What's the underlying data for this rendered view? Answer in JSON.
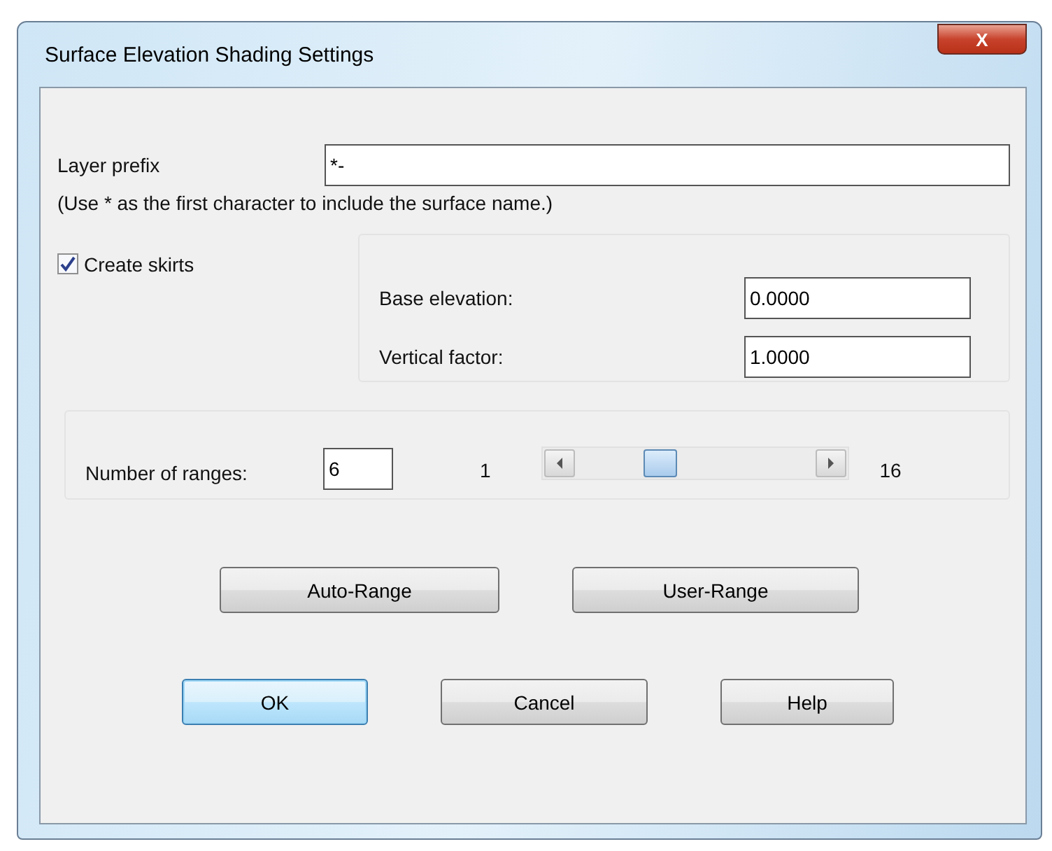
{
  "window": {
    "title": "Surface Elevation Shading Settings",
    "close_label": "X"
  },
  "layer_prefix": {
    "label": "Layer prefix",
    "value": "*-",
    "hint": "(Use * as the first character to include the surface name.)"
  },
  "create_skirts": {
    "label": "Create skirts",
    "checked": true
  },
  "skirt_fields": [
    {
      "label": "Base elevation:",
      "value": "0.0000"
    },
    {
      "label": "Vertical factor:",
      "value": "1.0000"
    }
  ],
  "ranges": {
    "label": "Number of ranges:",
    "value": "6",
    "min_label": "1",
    "max_label": "16",
    "level": 0.33
  },
  "range_buttons": [
    "Auto-Range",
    "User-Range"
  ],
  "buttons": [
    {
      "label": "OK",
      "selected": true
    },
    {
      "label": "Cancel",
      "selected": false
    },
    {
      "label": "Help",
      "selected": false
    }
  ]
}
